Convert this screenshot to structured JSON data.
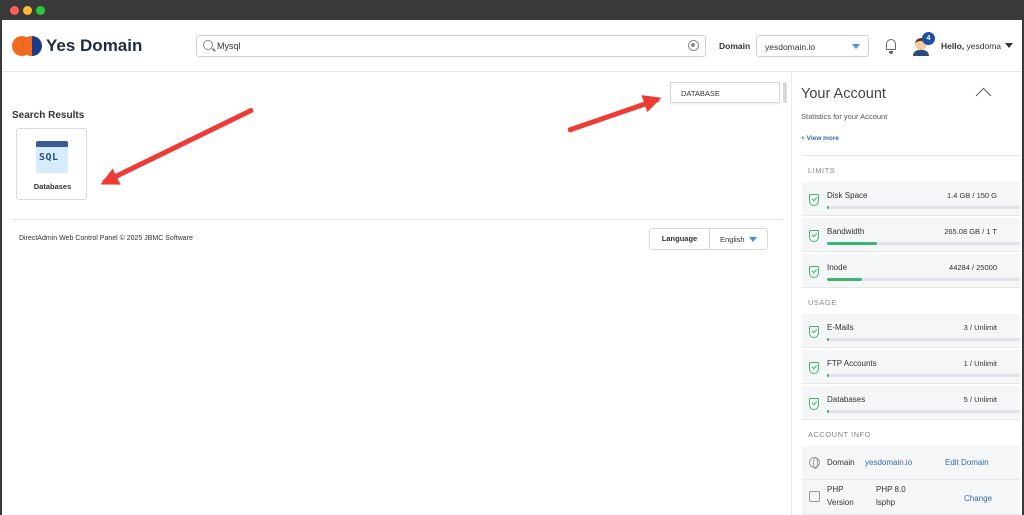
{
  "header": {
    "brand": "Yes Domain",
    "search_value": "Mysql",
    "domain_label": "Domain",
    "domain_value": "yesdomain.io",
    "notifications_count": "4",
    "greeting": "Hello,",
    "username": "yesdomai"
  },
  "suggestion": {
    "label": "DATABASE"
  },
  "results": {
    "title": "Search Results",
    "items": [
      {
        "icon_text": "SQL",
        "label": "Databases"
      }
    ]
  },
  "footer": {
    "copyright": "DirectAdmin Web Control Panel © 2025 JBMC Software",
    "language_label": "Language",
    "language_value": "English"
  },
  "account": {
    "title": "Your Account",
    "subtitle": "Statistics for your Account",
    "view_more": "+ View more",
    "limits_label": "LIMITS",
    "limits": [
      {
        "name": "Disk Space",
        "value": "1.4 GB / 150 G",
        "fill": 0.01
      },
      {
        "name": "Bandwidth",
        "value": "265.08 GB / 1 T",
        "fill": 0.26
      },
      {
        "name": "Inode",
        "value": "44284 / 25000",
        "fill": 0.18
      }
    ],
    "usage_label": "USAGE",
    "usage": [
      {
        "name": "E-Mails",
        "value": "3 / Unlimit",
        "fill": 0.01
      },
      {
        "name": "FTP Accounts",
        "value": "1 / Unlimit",
        "fill": 0.01
      },
      {
        "name": "Databases",
        "value": "5 / Unlimit",
        "fill": 0.01
      }
    ],
    "info_label": "ACCOUNT INFO",
    "info": {
      "domain_key": "Domain",
      "domain_value": "yesdomain.io",
      "domain_action": "Edit Domain",
      "php_key_1": "PHP",
      "php_key_2": "Version",
      "php_value_1": "PHP 8.0",
      "php_value_2": "lsphp",
      "php_action": "Change"
    }
  },
  "colors": {
    "accent_blue": "#2f6db5",
    "brand_orange": "#f26b21",
    "brand_navy": "#1e3a8a",
    "arrow_red": "#ef3b36",
    "success_green": "#3bb573"
  }
}
